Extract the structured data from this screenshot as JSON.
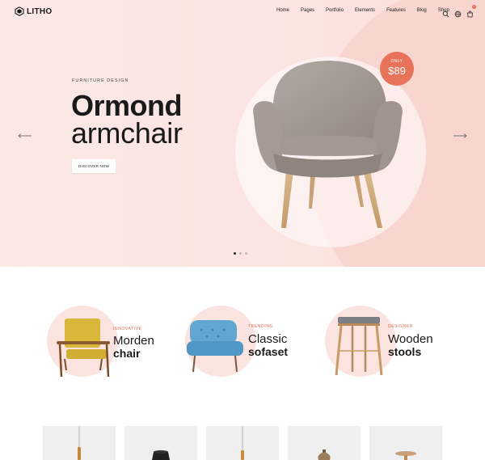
{
  "header": {
    "brand": "LITHO",
    "nav": [
      "Home",
      "Pages",
      "Portfolio",
      "Elements",
      "Features",
      "Blog",
      "Shop"
    ],
    "icons": [
      "search-icon",
      "globe-icon",
      "cart-icon"
    ],
    "cart_count": "0"
  },
  "hero": {
    "eyebrow": "FURNITURE DESIGN",
    "title_line1": "Ormond",
    "title_line2": "armchair",
    "cta": "DISCOVER NOW",
    "price_badge": {
      "label": "ONLY",
      "amount": "$89"
    },
    "slides": 3,
    "active_slide": 1
  },
  "categories": [
    {
      "tag": "INNOVATIVE",
      "title_light": "Morden",
      "title_bold": "chair"
    },
    {
      "tag": "TRENDING",
      "title_light": "Classic",
      "title_bold": "sofaset"
    },
    {
      "tag": "DESIGNER",
      "title_light": "Wooden",
      "title_bold": "stools"
    }
  ],
  "colors": {
    "accent": "#e26a4f",
    "hero_bg": "#fbe4e1",
    "hero_arc": "#f9d5d0",
    "category_disc": "#fbe3df",
    "product_card": "#efefef"
  }
}
